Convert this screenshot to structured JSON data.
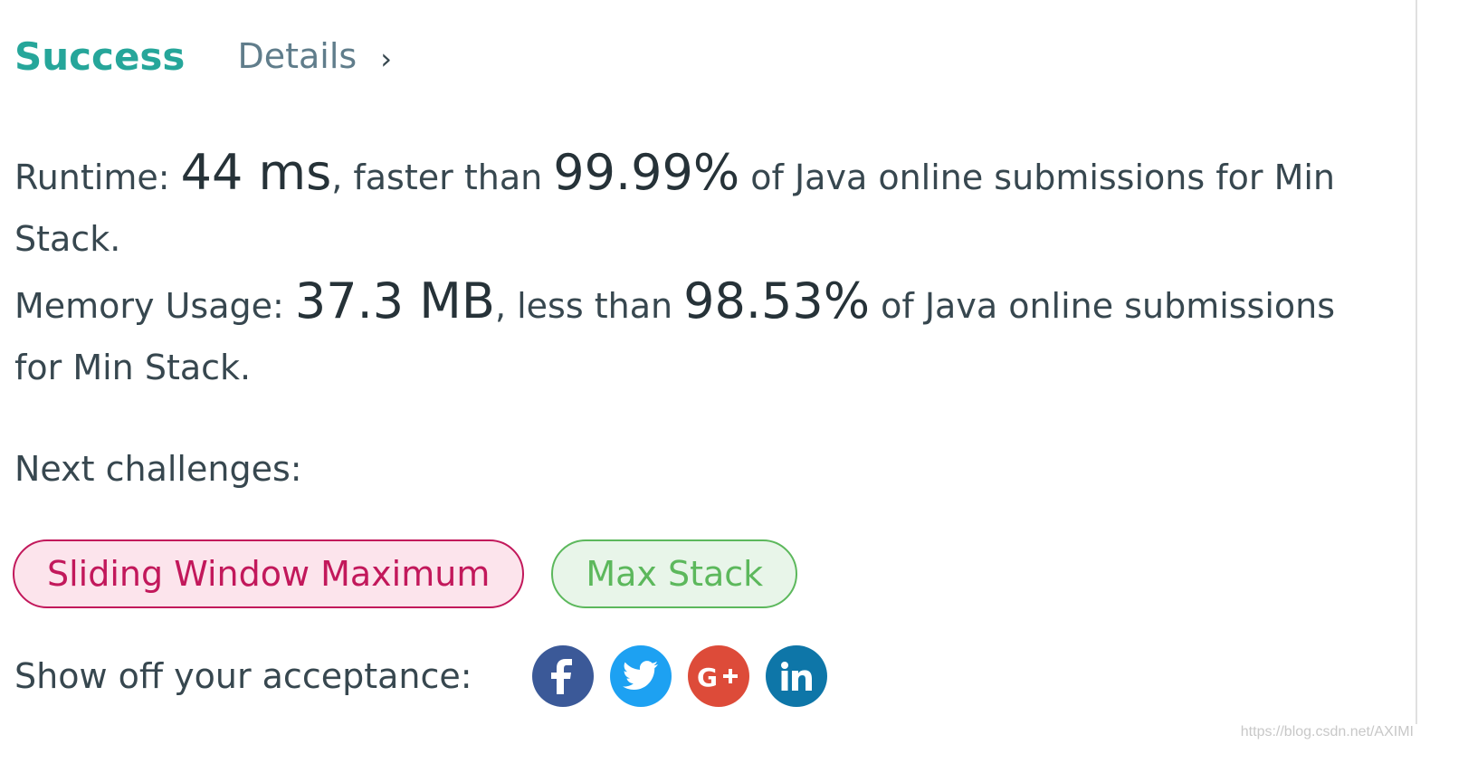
{
  "header": {
    "status": "Success",
    "details_label": "Details",
    "chevron": "›"
  },
  "runtime": {
    "label": "Runtime: ",
    "value": "44 ms",
    "comparison": ", faster than ",
    "percent": "99.99%",
    "suffix": " of Java online submissions for Min Stack."
  },
  "memory": {
    "label": "Memory Usage: ",
    "value": "37.3 MB",
    "comparison": ", less than ",
    "percent": "98.53%",
    "suffix": " of Java online submissions for Min Stack."
  },
  "next": {
    "label": "Next challenges:",
    "challenges": [
      {
        "title": "Sliding Window Maximum",
        "difficulty_color": "#c2185b"
      },
      {
        "title": "Max Stack",
        "difficulty_color": "#5cb85c"
      }
    ]
  },
  "share": {
    "label": "Show off your acceptance:",
    "icons": [
      {
        "name": "facebook-icon",
        "color": "#3b5998"
      },
      {
        "name": "twitter-icon",
        "color": "#1da1f2"
      },
      {
        "name": "google-plus-icon",
        "color": "#dd4b39"
      },
      {
        "name": "linkedin-icon",
        "color": "#0e76a8"
      }
    ]
  },
  "watermark": "https://blog.csdn.net/AXIMI"
}
